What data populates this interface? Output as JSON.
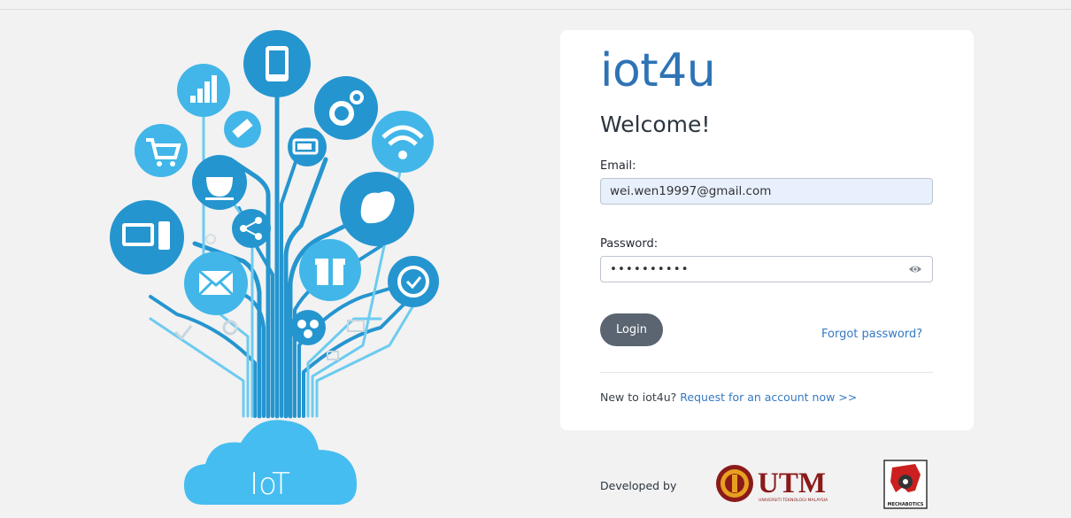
{
  "illustration": {
    "cloud_text": "IoT"
  },
  "login": {
    "brand": "iot4u",
    "welcome": "Welcome!",
    "email_label": "Email:",
    "email_value": "wei.wen19997@gmail.com",
    "password_label": "Password:",
    "password_value": "••••••••••",
    "login_button": "Login",
    "forgot_password": "Forgot password?",
    "new_user_prompt": "New to iot4u?",
    "request_account": "Request for an account now >>"
  },
  "footer": {
    "developed_by": "Developed by",
    "utm_logo_text": "UTM",
    "utm_subtext": "UNIVERSITI TEKNOLOGI MALAYSIA",
    "mech_logo_text": "MECHABOTICS"
  },
  "colors": {
    "brand": "#2e73b5",
    "link": "#3579c4",
    "button": "#5a6571",
    "illustration_primary": "#3aaee0",
    "utm_maroon": "#8b1a1a"
  }
}
